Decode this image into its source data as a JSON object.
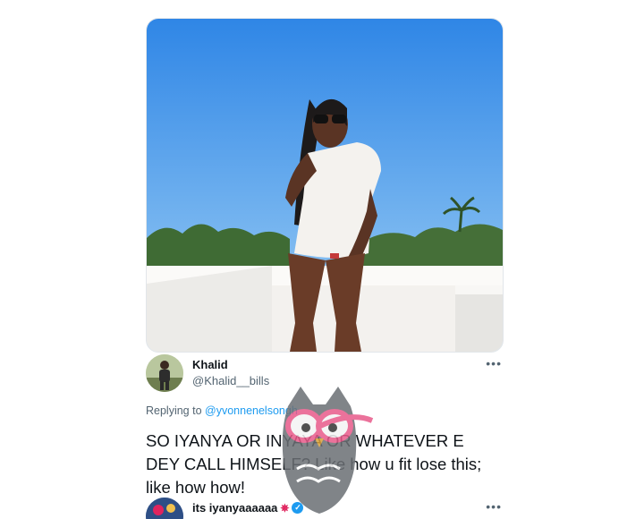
{
  "reply": {
    "display_name": "Khalid",
    "handle": "@Khalid__bills",
    "more_label": "•••",
    "replying_prefix": "Replying to",
    "replying_mention": "@yvonnenelsongh",
    "text": "SO IYANYA OR INYAYA OR WHATEVER E DEY CALL HIMSELF? Like how u fit lose this; like how how!"
  },
  "next_reply": {
    "display_name": "its iyanyaaaaaa",
    "star_glyph": "✵",
    "verified_glyph": "✓",
    "more_label": "•••"
  },
  "colors": {
    "link": "#1d9bf0",
    "secondary_text": "#536471",
    "primary_text": "#0f1419",
    "sky": "#3f8fe0"
  },
  "icons": {
    "more": "ellipsis-icon",
    "verified": "verified-badge-icon",
    "watermark": "owl-watermark-icon"
  }
}
